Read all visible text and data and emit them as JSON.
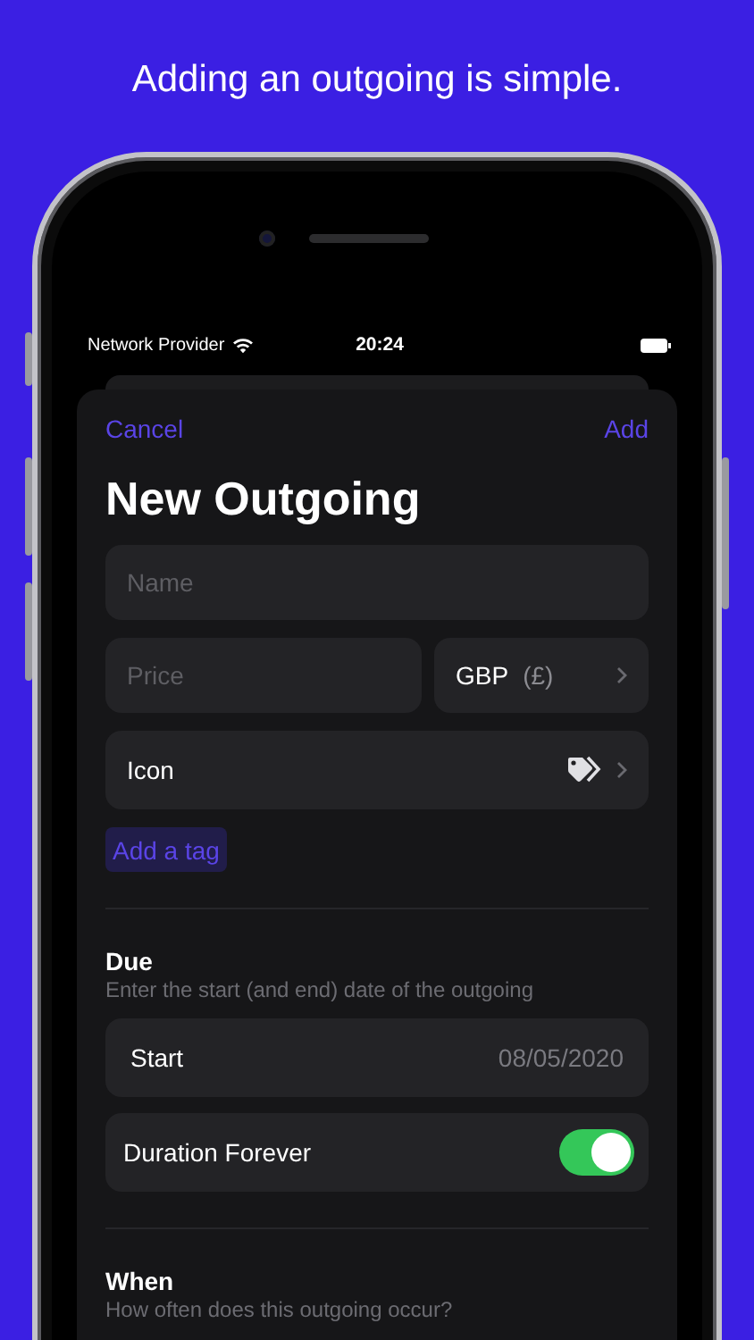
{
  "headline": "Adding an outgoing is simple.",
  "status_bar": {
    "carrier": "Network Provider",
    "time": "20:24"
  },
  "nav": {
    "cancel": "Cancel",
    "add": "Add"
  },
  "title": "New Outgoing",
  "name_field": {
    "placeholder": "Name"
  },
  "price_field": {
    "placeholder": "Price"
  },
  "currency": {
    "code": "GBP",
    "symbol": "(£)"
  },
  "icon_row": {
    "label": "Icon"
  },
  "tag_button": "Add a tag",
  "sections": [
    {
      "title": "Due",
      "subtitle": "Enter the start (and end) date of the outgoing",
      "rows": [
        {
          "kind": "value",
          "label": "Start",
          "value": "08/05/2020"
        },
        {
          "kind": "toggle",
          "label": "Duration Forever",
          "on": true
        }
      ]
    },
    {
      "title": "When",
      "subtitle": "How often does this outgoing occur?"
    }
  ]
}
